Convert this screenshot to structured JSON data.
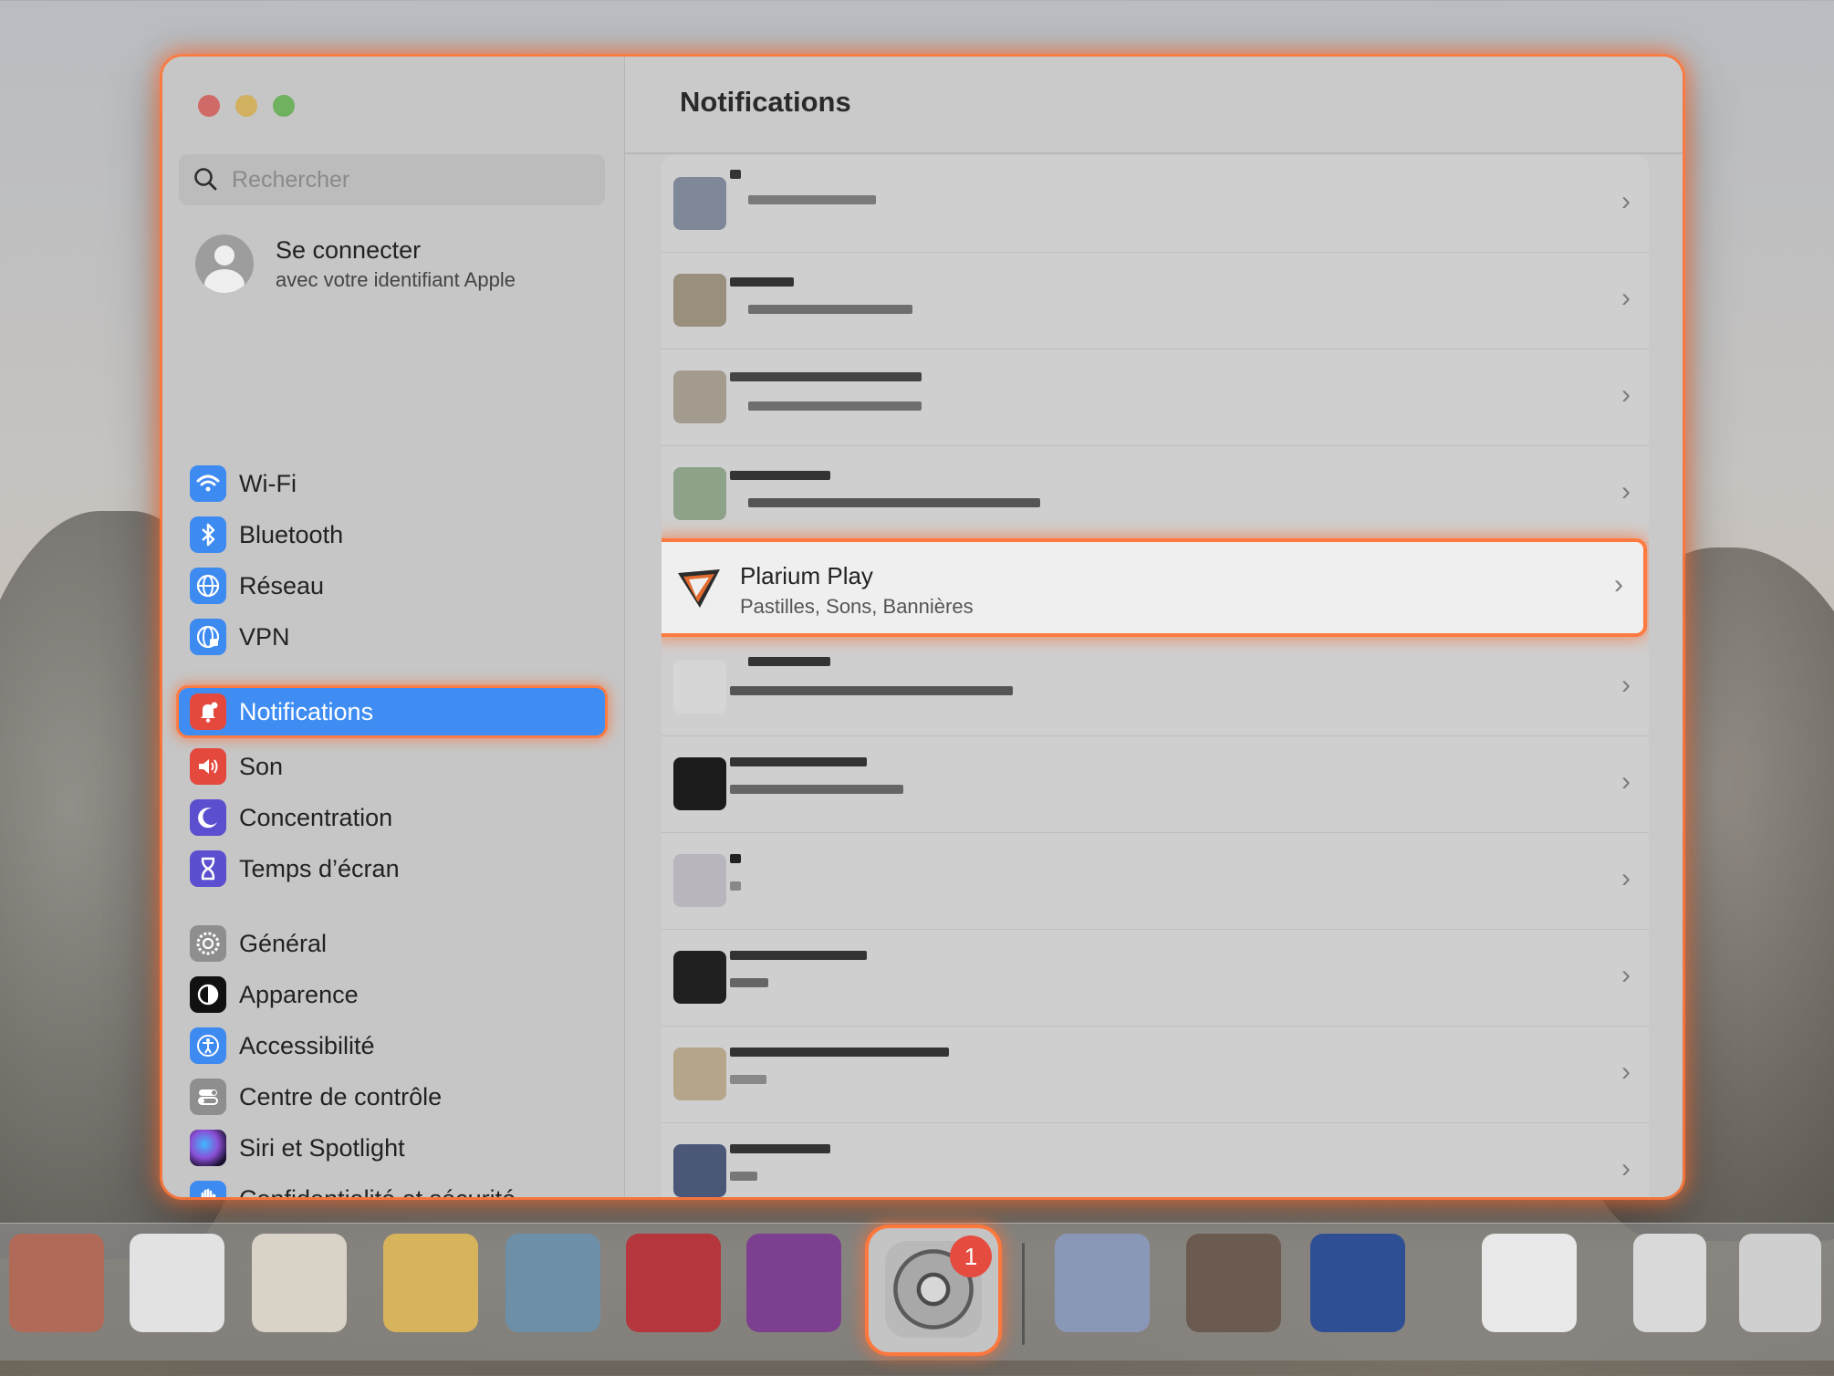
{
  "window": {
    "title": "Notifications"
  },
  "sidebar": {
    "search": {
      "placeholder": "Rechercher",
      "value": ""
    },
    "account": {
      "title": "Se connecter",
      "subtitle": "avec votre identifiant Apple"
    },
    "items": [
      {
        "label": "Wi-Fi",
        "icon": "wifi-icon",
        "color": "#3d8af0"
      },
      {
        "label": "Bluetooth",
        "icon": "bluetooth-icon",
        "color": "#3d8af0"
      },
      {
        "label": "Réseau",
        "icon": "globe-icon",
        "color": "#3d8af0"
      },
      {
        "label": "VPN",
        "icon": "vpn-globe-icon",
        "color": "#3d8af0"
      },
      {
        "label": "Notifications",
        "icon": "bell-icon",
        "color": "#e5483d",
        "active": true
      },
      {
        "label": "Son",
        "icon": "speaker-icon",
        "color": "#e5483d"
      },
      {
        "label": "Concentration",
        "icon": "moon-icon",
        "color": "#5b4fd0"
      },
      {
        "label": "Temps d’écran",
        "icon": "hourglass-icon",
        "color": "#5b4fd0"
      },
      {
        "label": "Général",
        "icon": "gear-icon",
        "color": "#8e8e8e"
      },
      {
        "label": "Apparence",
        "icon": "appearance-icon",
        "color": "#111111"
      },
      {
        "label": "Accessibilité",
        "icon": "accessibility-icon",
        "color": "#3d8af0"
      },
      {
        "label": "Centre de contrôle",
        "icon": "control-center-icon",
        "color": "#8e8e8e"
      },
      {
        "label": "Siri et Spotlight",
        "icon": "siri-icon",
        "color": "#5b2f8a"
      },
      {
        "label": "Confidentialité et sécurité",
        "icon": "hand-icon",
        "color": "#3d8af0"
      }
    ]
  },
  "main": {
    "featured_app": {
      "name": "Plarium Play",
      "subtitle": "Pastilles, Sons, Bannières",
      "icon": "plarium-play-icon"
    },
    "chevron": "›"
  },
  "dock": {
    "settings_badge": "1",
    "settings_icon": "system-settings-icon"
  }
}
